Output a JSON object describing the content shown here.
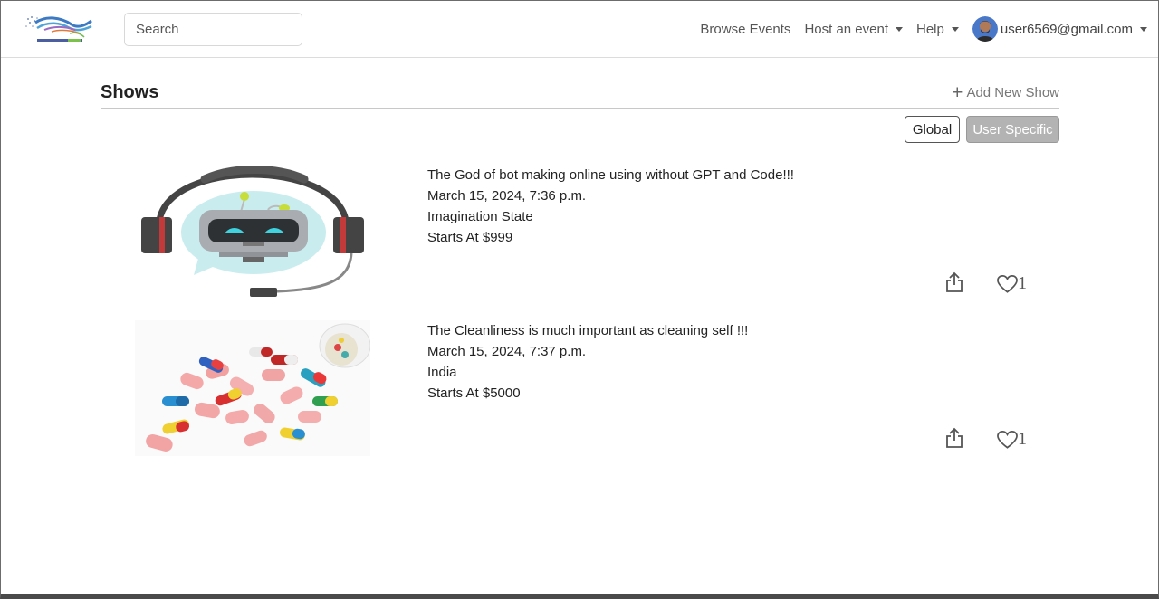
{
  "navbar": {
    "search_placeholder": "Search",
    "browse_events": "Browse Events",
    "host_event": "Host an event",
    "help": "Help",
    "user_email": "user6569@gmail.com"
  },
  "page": {
    "title": "Shows",
    "add_new_show": "Add New Show",
    "filter_global": "Global",
    "filter_user_specific": "User Specific"
  },
  "shows": [
    {
      "title": "The God of bot making online using without GPT and Code!!!",
      "datetime": "March 15, 2024, 7:36 p.m.",
      "location": "Imagination State",
      "price": "Starts At $999",
      "likes": "1",
      "image": "robot-headset-icon"
    },
    {
      "title": "The Cleanliness is much important as cleaning self !!!",
      "datetime": "March 15, 2024, 7:37 p.m.",
      "location": "India",
      "price": "Starts At $5000",
      "likes": "1",
      "image": "pills-capsules-image"
    }
  ]
}
